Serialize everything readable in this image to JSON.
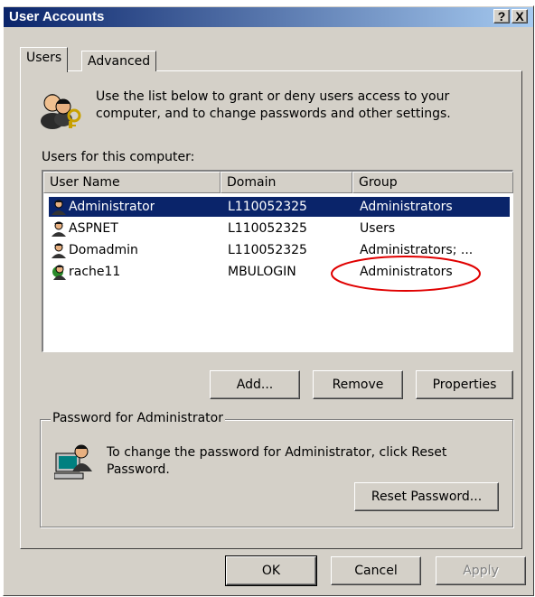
{
  "window": {
    "title": "User Accounts",
    "help_button": "?",
    "close_button": "X"
  },
  "tabs": [
    {
      "label": "Users",
      "active": true
    },
    {
      "label": "Advanced",
      "active": false
    }
  ],
  "intro": {
    "text_line1": "Use the list below to grant or deny users access to your",
    "text_line2": "computer, and to change passwords and other settings.",
    "icon": "users-keys-icon"
  },
  "users_list": {
    "label": "Users for this computer:",
    "columns": [
      "User Name",
      "Domain",
      "Group"
    ],
    "rows": [
      {
        "name": "Administrator",
        "domain": "L110052325",
        "group": "Administrators",
        "selected": true
      },
      {
        "name": "ASPNET",
        "domain": "L110052325",
        "group": "Users",
        "selected": false
      },
      {
        "name": "Domadmin",
        "domain": "L110052325",
        "group": "Administrators; ...",
        "selected": false
      },
      {
        "name": "rache11",
        "domain": "MBULOGIN",
        "group": "Administrators",
        "selected": false
      }
    ],
    "annotation_color": "#e00000"
  },
  "list_buttons": {
    "add": "Add...",
    "remove": "Remove",
    "properties": "Properties"
  },
  "password": {
    "group_label": "Password for Administrator",
    "text_line1": "To change the password for Administrator, click Reset",
    "text_line2": "Password.",
    "reset_button": "Reset Password...",
    "icon": "computer-user-icon"
  },
  "dialog_buttons": {
    "ok": "OK",
    "cancel": "Cancel",
    "apply": "Apply",
    "apply_enabled": false
  },
  "colors": {
    "face": "#d4d0c8",
    "title_start": "#0a246a",
    "title_end": "#a6caf0",
    "selection": "#0a246a"
  }
}
